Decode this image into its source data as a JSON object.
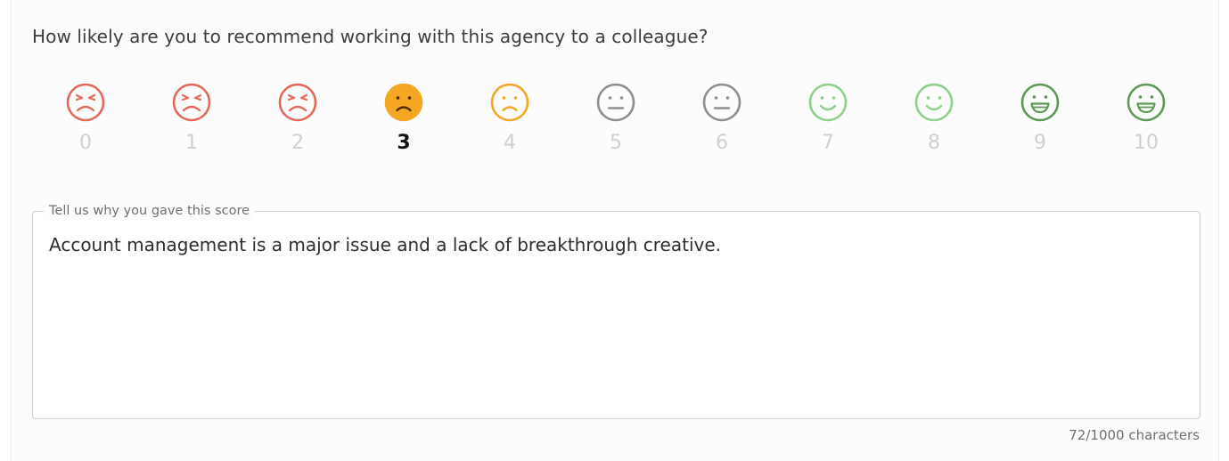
{
  "question": "How likely are you to recommend working with this agency to a colleague?",
  "selected_score": 3,
  "colors": {
    "very_angry": "#e5695b",
    "sad": "#f5a623",
    "neutral": "#8f8f8f",
    "happy_light": "#8fd18b",
    "happy_dark": "#5d9a56"
  },
  "scale": [
    {
      "label": "0",
      "icon": "angry-face-icon",
      "color": "#e5695b"
    },
    {
      "label": "1",
      "icon": "angry-face-icon",
      "color": "#e5695b"
    },
    {
      "label": "2",
      "icon": "angry-face-icon",
      "color": "#e5695b"
    },
    {
      "label": "3",
      "icon": "sad-face-icon",
      "color": "#f5a623",
      "filled": true
    },
    {
      "label": "4",
      "icon": "sad-face-icon",
      "color": "#f5a623"
    },
    {
      "label": "5",
      "icon": "neutral-face-icon",
      "color": "#8f8f8f"
    },
    {
      "label": "6",
      "icon": "neutral-face-icon",
      "color": "#8f8f8f"
    },
    {
      "label": "7",
      "icon": "smile-face-icon",
      "color": "#8fd18b"
    },
    {
      "label": "8",
      "icon": "smile-face-icon",
      "color": "#8fd18b"
    },
    {
      "label": "9",
      "icon": "grin-face-icon",
      "color": "#5d9a56"
    },
    {
      "label": "10",
      "icon": "grin-face-icon",
      "color": "#5d9a56"
    }
  ],
  "comment": {
    "legend": "Tell us why you gave this score",
    "value": "Account management is a major issue and a lack of breakthrough creative.",
    "counter": "72/1000 characters"
  }
}
